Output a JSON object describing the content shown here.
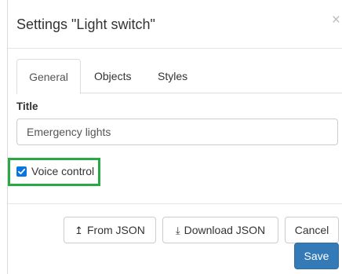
{
  "dialog": {
    "title": "Settings \"Light switch\"",
    "close_glyph": "×"
  },
  "tabs": [
    {
      "label": "General",
      "active": true
    },
    {
      "label": "Objects",
      "active": false
    },
    {
      "label": "Styles",
      "active": false
    }
  ],
  "form": {
    "title_label": "Title",
    "title_value": "Emergency lights",
    "voice_control_label": "Voice control",
    "voice_control_checked": true
  },
  "buttons": {
    "from_json_icon": "↥",
    "from_json": "From JSON",
    "download_json_icon": "⤓",
    "download_json": "Download JSON",
    "cancel": "Cancel",
    "save": "Save"
  },
  "colors": {
    "primary": "#337ab7",
    "checkbox": "#0b74e5",
    "highlight": "#2aa846"
  }
}
